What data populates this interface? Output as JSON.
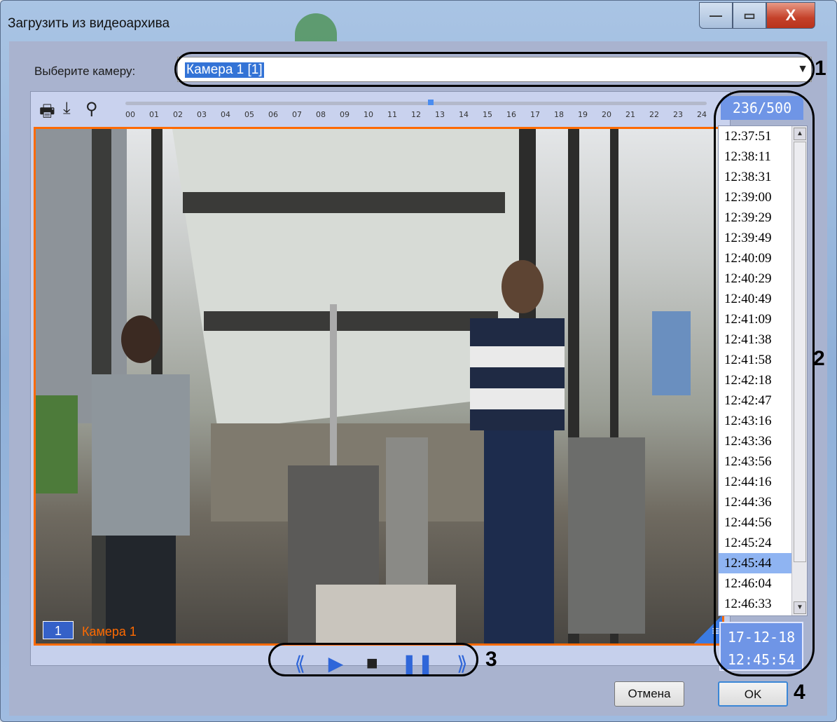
{
  "window": {
    "title": "Загрузить из видеоархива",
    "buttons": {
      "minimize": "—",
      "maximize": "▭",
      "close": "X"
    }
  },
  "camera_select": {
    "label": "Выберите камеру:",
    "value": "Камера 1 [1]"
  },
  "markers": {
    "m1": "1",
    "m2": "2",
    "m3": "3",
    "m4": "4"
  },
  "timeline": {
    "ticks": [
      "00",
      "01",
      "02",
      "03",
      "04",
      "05",
      "06",
      "07",
      "08",
      "09",
      "10",
      "11",
      "12",
      "13",
      "14",
      "15",
      "16",
      "17",
      "18",
      "19",
      "20",
      "21",
      "22",
      "23",
      "24"
    ],
    "current_position_fraction": 0.52
  },
  "video": {
    "camera_number": "1",
    "camera_name": "Камера 1"
  },
  "playback": {
    "rewind": "⟪",
    "play": "▶",
    "stop": "■",
    "pause": "❚❚",
    "forward": "⟫"
  },
  "frames": {
    "counter": "236/500",
    "times": [
      "12:37:51",
      "12:38:11",
      "12:38:31",
      "12:39:00",
      "12:39:29",
      "12:39:49",
      "12:40:09",
      "12:40:29",
      "12:40:49",
      "12:41:09",
      "12:41:38",
      "12:41:58",
      "12:42:18",
      "12:42:47",
      "12:43:16",
      "12:43:36",
      "12:43:56",
      "12:44:16",
      "12:44:36",
      "12:44:56",
      "12:45:24",
      "12:45:44",
      "12:46:04",
      "12:46:33"
    ],
    "selected": "12:45:44",
    "date": "17-12-18",
    "time": "12:45:54"
  },
  "actions": {
    "cancel": "Отмена",
    "ok": "OK"
  },
  "colors": {
    "accent": "#3373d6",
    "video_border": "#ff6a00",
    "selected_row": "#8fb4f2"
  }
}
